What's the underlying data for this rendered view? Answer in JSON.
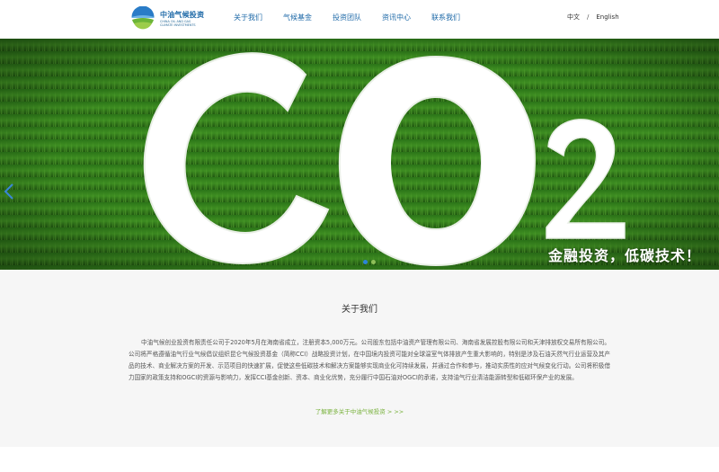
{
  "header": {
    "logo": {
      "name_cn": "中油气候投资",
      "name_en_1": "CHINA OIL AND GAS",
      "name_en_2": "CLIMATE INVESTMENTS"
    },
    "nav": [
      {
        "label": "关于我们"
      },
      {
        "label": "气候基金"
      },
      {
        "label": "投资团队"
      },
      {
        "label": "资讯中心"
      },
      {
        "label": "联系我们"
      }
    ],
    "lang": {
      "zh": "中文",
      "sep": "/",
      "en": "English"
    }
  },
  "banner": {
    "slogan": "金融投资，低碳技术！",
    "slides_total": 2,
    "active_slide": 1,
    "colors": {
      "grass_dark": "#1f5c10",
      "grass_light": "#4e9a2a",
      "dot_active": "#2c85d8",
      "dot_inactive": "#8fbf59"
    }
  },
  "about": {
    "title": "关于我们",
    "body": "中油气候创业投资有限责任公司于2020年5月在海南省成立，注册资本5,000万元。公司股东包括中油资产管理有限公司、海南省发展控股有限公司和天津排放权交易所有限公司。公司将严格遵循油气行业气候倡议组织昆仑气候投资基金（简称CCI）战略投资计划，在中国境内投资可能对全球温室气体排放产生重大影响的，特别是涉及石油天然气行业运营及其产品的技术、商业解决方案的开发、示范项目的快速扩展，促使这些低碳技术和解决方案能够实现商业化可持续发展，并通过合作和参与，推动实质性的应对气候变化行动。公司将积极借力国家的政策支持和OGCI的资源与影响力，发挥CCI基金创新、资本、商业化优势，充分履行中国石油对OGCI的承诺，支持油气行业清洁能源转型和低碳环保产业的发展。",
    "more_link": "了解更多关于中油气候投资 > >>"
  }
}
